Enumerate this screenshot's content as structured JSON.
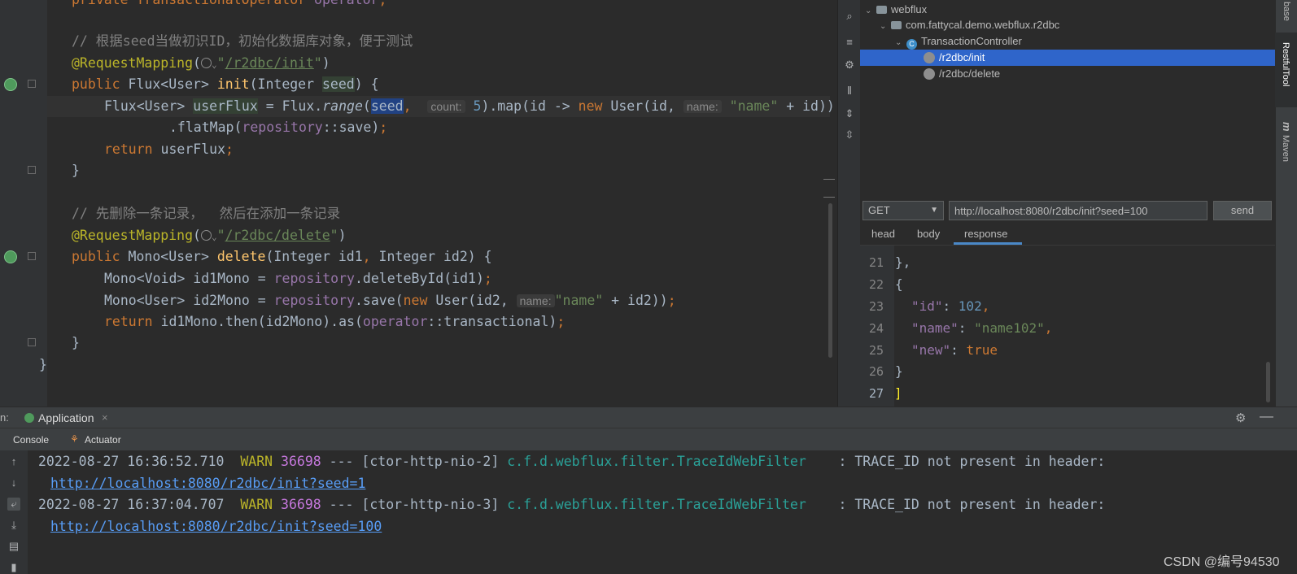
{
  "editor": {
    "lines": {
      "l0_type": "private TransactionalOperator ",
      "l0_field": "operator",
      "l0_end": ";",
      "c1": "// 根据seed当做初识ID，初始化数据库对象，便于测试",
      "rm1_ann": "@RequestMapping",
      "rm1_path": "/r2dbc/init",
      "init_sig_a": "public ",
      "init_sig_b": "Flux<User> ",
      "init_name": "init",
      "init_sig_c": "(Integer ",
      "init_param": "seed",
      "init_sig_d": ") {",
      "flux_a": "Flux<User> ",
      "flux_var": "userFlux",
      "flux_b": " = Flux.",
      "flux_range": "range",
      "flux_c": "(",
      "flux_seed": "seed",
      "flux_comma": ", ",
      "hint_count": "count:",
      "flux_five": "5",
      "flux_d": ").map(id -> ",
      "flux_new": "new ",
      "flux_e": "User(id, ",
      "hint_name": "name:",
      "flux_str": "\"name\"",
      "flux_f": " + id))",
      "flatmap_a": ".flatMap(",
      "flatmap_repo": "repository",
      "flatmap_b": "::save)",
      "flatmap_end": ";",
      "ret1_kw": "return ",
      "ret1_b": "userFlux",
      "ret1_end": ";",
      "brace1": "}",
      "c2": "// 先删除一条记录，  然后在添加一条记录",
      "rm2_ann": "@RequestMapping",
      "rm2_path": "/r2dbc/delete",
      "del_a": "public ",
      "del_b": "Mono<User> ",
      "del_name": "delete",
      "del_c": "(Integer id1",
      "del_comma": ", ",
      "del_d": "Integer id2) {",
      "m1_a": "Mono<Void> id1Mono = ",
      "m1_repo": "repository",
      "m1_b": ".deleteById(id1)",
      "m1_end": ";",
      "m2_a": "Mono<User> id2Mono = ",
      "m2_repo": "repository",
      "m2_b": ".save(",
      "m2_new": "new ",
      "m2_c": "User(id2, ",
      "m2_hint": "name:",
      "m2_str": "\"name\"",
      "m2_d": " + id2))",
      "m2_end": ";",
      "ret2_kw": "return ",
      "ret2_b": "id1Mono.then(id2Mono).as(",
      "ret2_op": "operator",
      "ret2_c": "::transactional)",
      "ret2_end": ";",
      "brace2": "}",
      "brace3": "}"
    }
  },
  "tree": {
    "root": "webflux",
    "package": "com.fattycal.demo.webflux.r2dbc",
    "controller": "TransactionController",
    "endpoints": [
      "/r2dbc/init",
      "/r2dbc/delete"
    ]
  },
  "request": {
    "method": "GET",
    "url": "http://localhost:8080/r2dbc/init?seed=100",
    "send_label": "send",
    "tabs": [
      "head",
      "body",
      "response"
    ]
  },
  "response": {
    "line_numbers": [
      "21",
      "22",
      "23",
      "24",
      "25",
      "26",
      "27"
    ],
    "close_brace": "},",
    "open_brace": "{",
    "id_key": "\"id\"",
    "id_val": "102",
    "name_key": "\"name\"",
    "name_val": "\"name102\"",
    "new_key": "\"new\"",
    "new_val": "true",
    "colon": ": ",
    "comma": ",",
    "end_brace": "}",
    "end_bracket": "]"
  },
  "side_strip": {
    "top_label": "base",
    "restful": "RestfulTool",
    "maven": "Maven"
  },
  "run": {
    "prefix": "n:",
    "tab": "Application",
    "close": "×",
    "console_tab": "Console",
    "actuator_tab": "Actuator"
  },
  "console": {
    "log1_ts": "2022-08-27 16:36:52.710  ",
    "log1_lvl": "WARN",
    "log1_pid": " 36698",
    "log1_thread": " --- [ctor-http-nio-2] ",
    "log1_logger": "c.f.d.webflux.filter.TraceIdWebFilter",
    "log1_msg": "    : TRACE_ID not present in header:",
    "log1_link": "http://localhost:8080/r2dbc/init?seed=1",
    "log2_ts": "2022-08-27 16:37:04.707  ",
    "log2_lvl": "WARN",
    "log2_pid": " 36698",
    "log2_thread": " --- [ctor-http-nio-3] ",
    "log2_logger": "c.f.d.webflux.filter.TraceIdWebFilter",
    "log2_msg": "    : TRACE_ID not present in header:",
    "log2_link": "http://localhost:8080/r2dbc/init?seed=100"
  },
  "watermark": "CSDN @编号94530",
  "colors": {
    "keyword": "#cc7832",
    "annotation": "#bbb529",
    "string": "#6a8759",
    "selection": "#2f65ca"
  }
}
